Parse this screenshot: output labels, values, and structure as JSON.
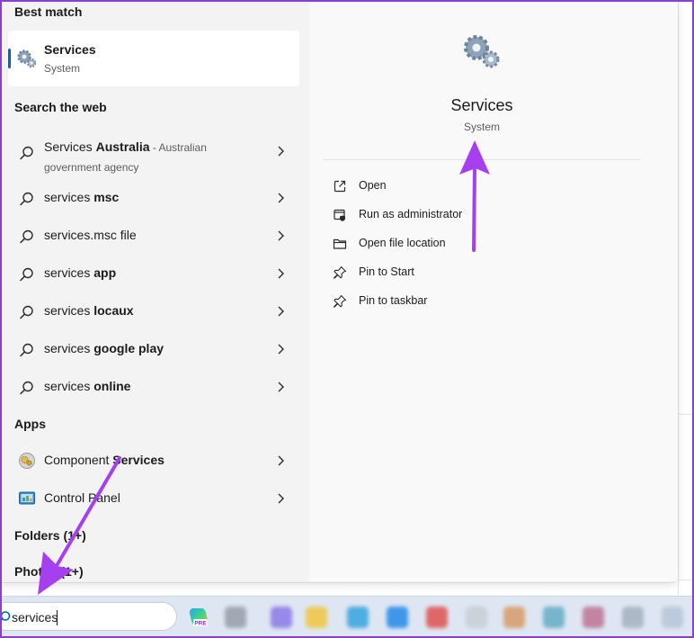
{
  "best_match": {
    "heading": "Best match",
    "app_name": "Services",
    "app_type": "System",
    "icon": "gears-icon"
  },
  "web": {
    "heading": "Search the web",
    "items": [
      {
        "prefix": "Services ",
        "bold": "Australia",
        "hint": " - Australian government agency"
      },
      {
        "prefix": "services ",
        "bold": "msc"
      },
      {
        "prefix": "services.msc file",
        "bold": ""
      },
      {
        "prefix": "services ",
        "bold": "app"
      },
      {
        "prefix": "services ",
        "bold": "locaux"
      },
      {
        "prefix": "services ",
        "bold": "google play"
      },
      {
        "prefix": "services ",
        "bold": "online"
      }
    ]
  },
  "apps": {
    "heading": "Apps",
    "items": [
      {
        "prefix": "Component ",
        "bold": "Services",
        "icon": "component-services-icon"
      },
      {
        "prefix": "Control Panel",
        "bold": "",
        "icon": "control-panel-icon"
      }
    ]
  },
  "folders": {
    "heading": "Folders (1+)"
  },
  "photos": {
    "heading": "Photos (1+)"
  },
  "detail": {
    "title": "Services",
    "subtitle": "System",
    "actions": [
      {
        "label": "Open",
        "icon": "open-external-icon"
      },
      {
        "label": "Run as administrator",
        "icon": "shield-admin-icon"
      },
      {
        "label": "Open file location",
        "icon": "folder-icon"
      },
      {
        "label": "Pin to Start",
        "icon": "pin-icon"
      },
      {
        "label": "Pin to taskbar",
        "icon": "pin-icon"
      }
    ]
  },
  "taskbar": {
    "search_value": "services",
    "copilot_badge": "PRE"
  },
  "colors": {
    "accent": "#0067c0",
    "annotation": "#a63ff0",
    "panel": "#f3f3f3",
    "taskbar": "#dde6f2"
  }
}
